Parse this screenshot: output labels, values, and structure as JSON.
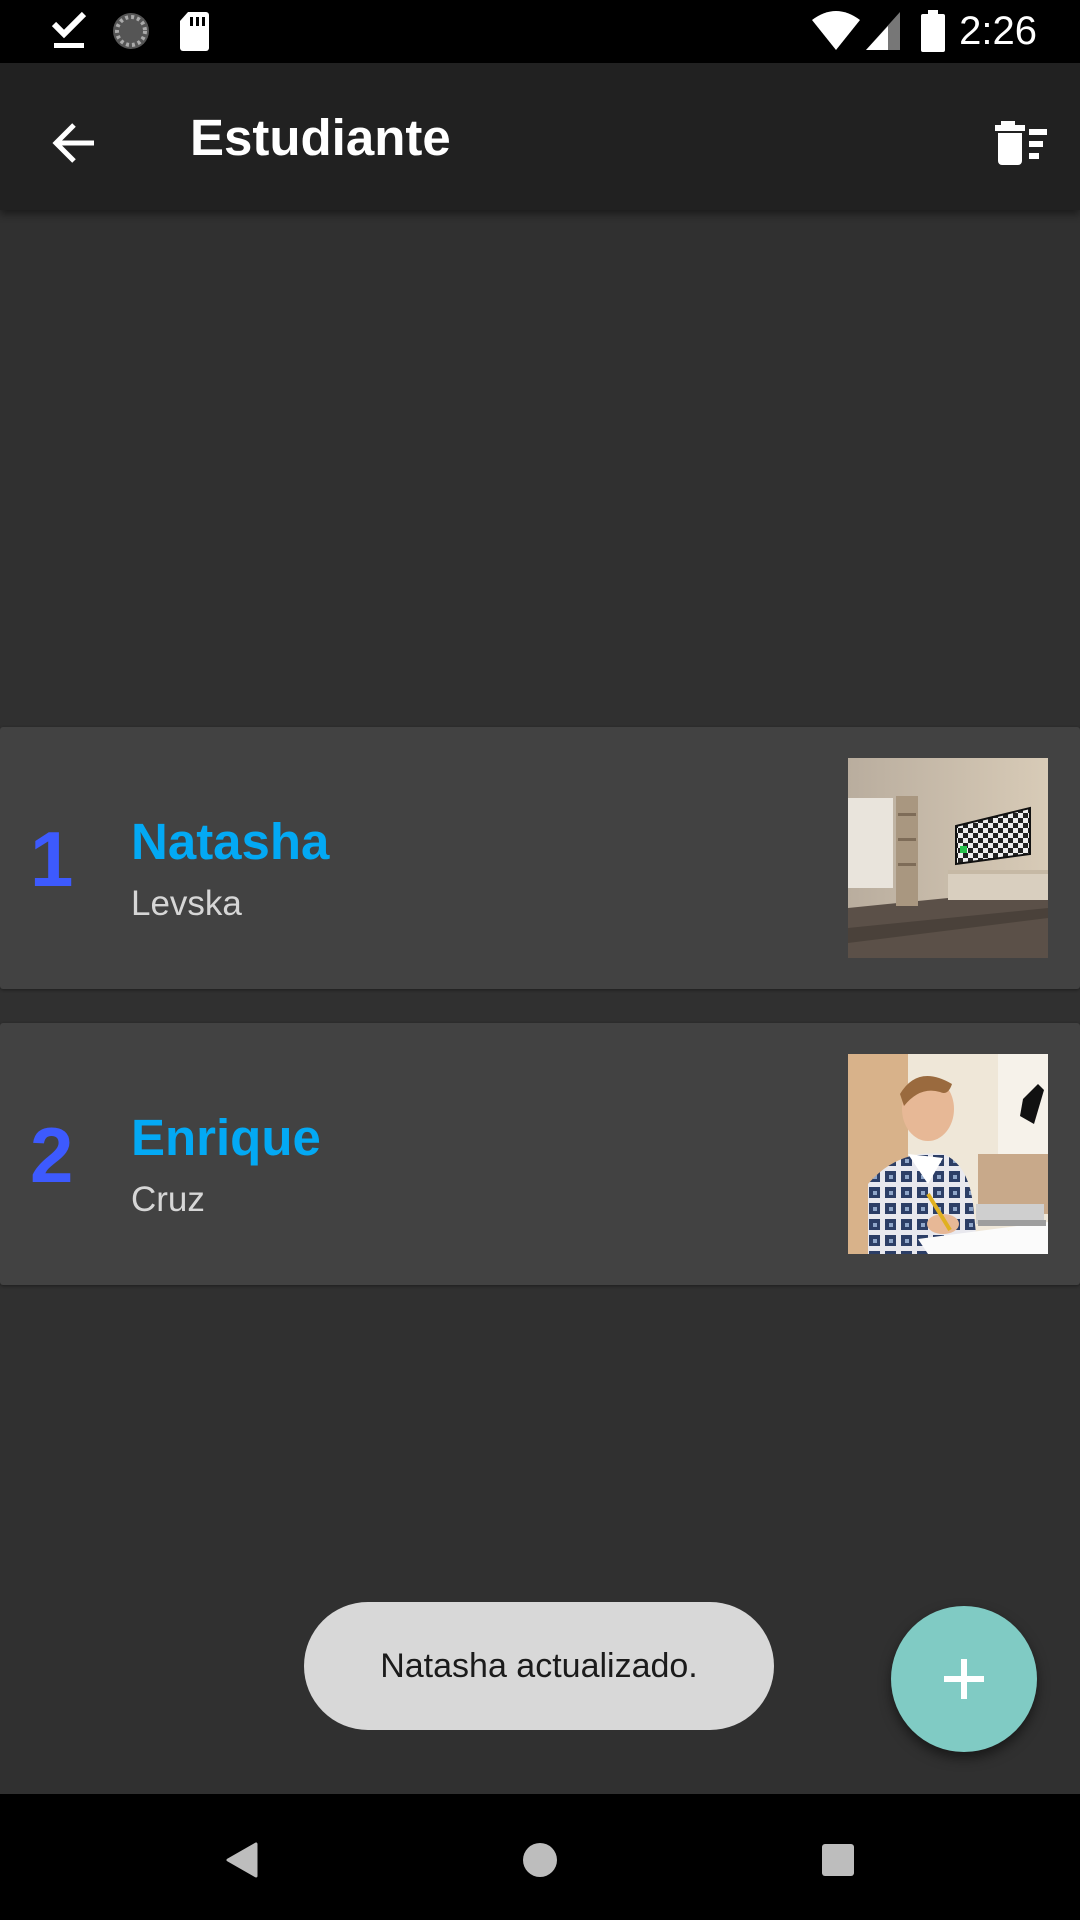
{
  "status_bar": {
    "time": "2:26",
    "left_icons": [
      "download-done-icon",
      "loading-spinner-icon",
      "sd-card-icon"
    ],
    "right_icons": [
      "wifi-icon",
      "cell-signal-icon",
      "battery-icon"
    ]
  },
  "toolbar": {
    "title": "Estudiante",
    "back_icon": "arrow-back-icon",
    "action_icon": "delete-sweep-icon"
  },
  "students": [
    {
      "number": "1",
      "first_name": "Natasha",
      "last_name": "Levska",
      "photo": "room-with-tv-photo"
    },
    {
      "number": "2",
      "first_name": "Enrique",
      "last_name": "Cruz",
      "photo": "student-writing-photo"
    }
  ],
  "toast": {
    "message": "Natasha actualizado."
  },
  "fab": {
    "icon": "add-icon"
  },
  "nav_bar": {
    "icons": [
      "back-triangle-icon",
      "home-circle-icon",
      "recents-square-icon"
    ]
  },
  "colors": {
    "background": "#303030",
    "toolbar": "#212121",
    "card": "#424242",
    "number": "#3d5afe",
    "first_name": "#03a9f4",
    "fab": "#80cbc4",
    "toast": "#d8d8d8"
  }
}
